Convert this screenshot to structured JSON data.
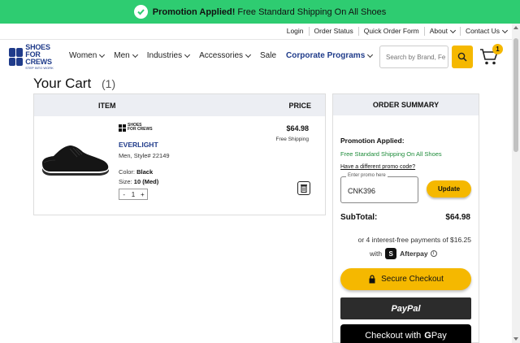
{
  "banner": {
    "bold": "Promotion Applied!",
    "text": "Free Standard Shipping On All Shoes",
    "icon": "check-circle-icon"
  },
  "utility_nav": {
    "login": "Login",
    "order_status": "Order Status",
    "quick_order": "Quick Order Form",
    "about": "About",
    "contact": "Contact Us"
  },
  "logo": {
    "line1": "SHOES",
    "line2": "FOR CREWS",
    "tagline": "STEP INTO WORK"
  },
  "main_nav": {
    "items": [
      "Women",
      "Men",
      "Industries",
      "Accessories",
      "Sale",
      "Corporate Programs"
    ]
  },
  "search": {
    "placeholder": "Search by Brand, Fe"
  },
  "cart": {
    "badge": "1",
    "title": "Your Cart",
    "count": "(1)"
  },
  "items_table": {
    "col_item": "ITEM",
    "col_price": "PRICE",
    "item": {
      "brand_line1": "SHOES",
      "brand_line2": "FOR CREWS",
      "name": "EVERLIGHT",
      "style": "Men, Style# 22149",
      "color_label": "Color:",
      "color": "Black",
      "size_label": "Size:",
      "size": "10 (Med)",
      "qty_minus": "-",
      "qty": "1",
      "qty_plus": "+",
      "price": "$64.98",
      "shipping": "Free Shipping"
    }
  },
  "summary": {
    "title": "ORDER SUMMARY",
    "promo_label": "Promotion Applied:",
    "promo_value": "Free Standard Shipping On All Shoes",
    "promo_link": "Have a different promo code?",
    "promo_placeholder": "Enter promo here",
    "promo_code": "CNK396",
    "update": "Update",
    "subtotal_label": "SubTotal:",
    "subtotal": "$64.98",
    "afterpay_line1": "or 4 interest-free payments of $16.25",
    "afterpay_with": "with",
    "afterpay_brand": "Afterpay",
    "secure_checkout": "Secure Checkout",
    "paypal": "PayPal",
    "gpay_prefix": "Checkout with",
    "gpay_g": "G",
    "gpay_suffix": "Pay"
  },
  "colors": {
    "banner_green": "#2ecc71",
    "accent_yellow": "#f5b800",
    "brand_blue": "#1f3b8a",
    "promo_green": "#1e8c3a"
  }
}
